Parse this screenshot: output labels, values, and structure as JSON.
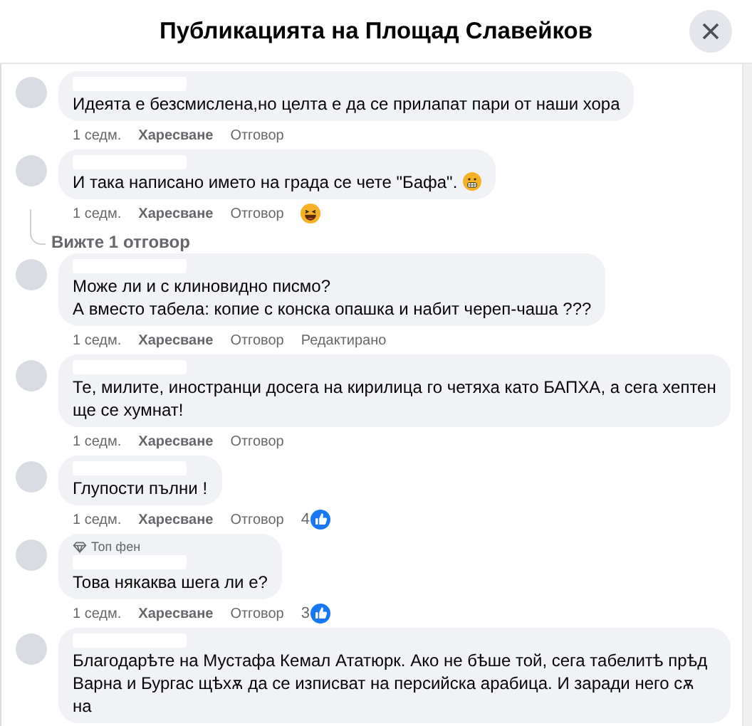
{
  "dialog": {
    "title": "Публикацията на Площад Славейков"
  },
  "comments": [
    {
      "lines": [
        "Идеята е безсмислена,но целта е да се прилапат пари от наши хора"
      ],
      "meta": {
        "time": "1 седм.",
        "like": "Харесване",
        "reply": "Отговор"
      }
    },
    {
      "lines": [
        "И така написано името на града се чете \"Бафа\"."
      ],
      "inline_emoji": {
        "kind": "grimace"
      },
      "meta": {
        "time": "1 седм.",
        "like": "Харесване",
        "reply": "Отговор"
      },
      "reaction": {
        "kind": "haha"
      },
      "thread": {
        "label": "Вижте 1 отговор"
      }
    },
    {
      "lines": [
        "Може ли и с клиновидно писмо?",
        "А вместо табела: копие с конска опашка и набит череп-чаша ???"
      ],
      "meta": {
        "time": "1 седм.",
        "like": "Харесване",
        "reply": "Отговор",
        "edited": "Редактирано"
      }
    },
    {
      "lines": [
        "Те, милите, иностранци досега на кирилица го четяха като БАПХА, а сега хептен ще се хумнат!"
      ],
      "meta": {
        "time": "1 седм.",
        "like": "Харесване",
        "reply": "Отговор"
      }
    },
    {
      "lines": [
        "Глупости пълни !"
      ],
      "meta": {
        "time": "1 седм.",
        "like": "Харесване",
        "reply": "Отговор"
      },
      "reaction": {
        "kind": "like",
        "count": "4"
      }
    },
    {
      "badge": "Топ фен",
      "lines": [
        "Това някаква шега ли е?"
      ],
      "meta": {
        "time": "1 седм.",
        "like": "Харесване",
        "reply": "Отговор"
      },
      "reaction": {
        "kind": "like",
        "count": "3"
      }
    },
    {
      "lines": [
        "Благодарѣте на Мустафа Кемал Ататюрк. Ако не бѣше той, сега табелитѣ прѣд Варна и Бургас щѣхѫ да се изписват на персийска арабица. И заради него сѫ на"
      ]
    }
  ]
}
